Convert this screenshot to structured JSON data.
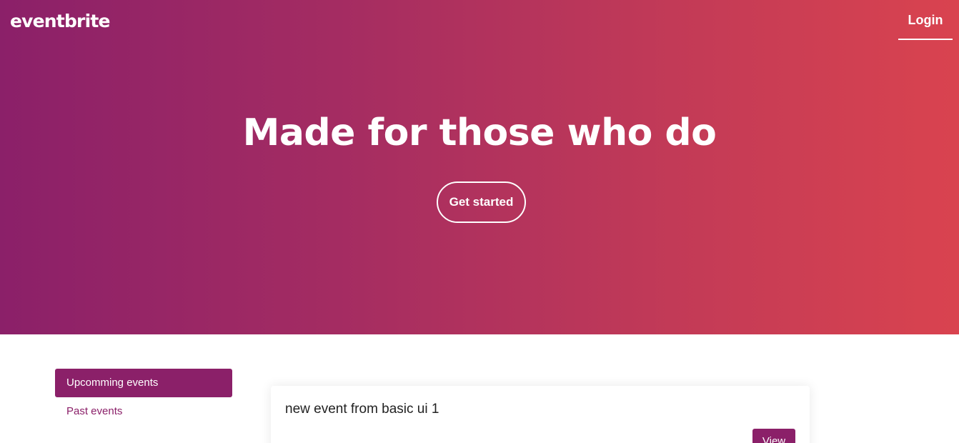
{
  "header": {
    "logo_text": "eventbrite",
    "login_label": "Login"
  },
  "hero": {
    "title": "Made for those who do",
    "cta_label": "Get started"
  },
  "sidebar": {
    "tabs": [
      {
        "label": "Upcomming events",
        "active": true
      },
      {
        "label": "Past events",
        "active": false
      }
    ]
  },
  "events": [
    {
      "title": "new event from basic ui 1",
      "action_label": "View"
    }
  ],
  "colors": {
    "brand": "#8b2069",
    "gradient_start": "#8b2069",
    "gradient_end": "#d9434f"
  }
}
